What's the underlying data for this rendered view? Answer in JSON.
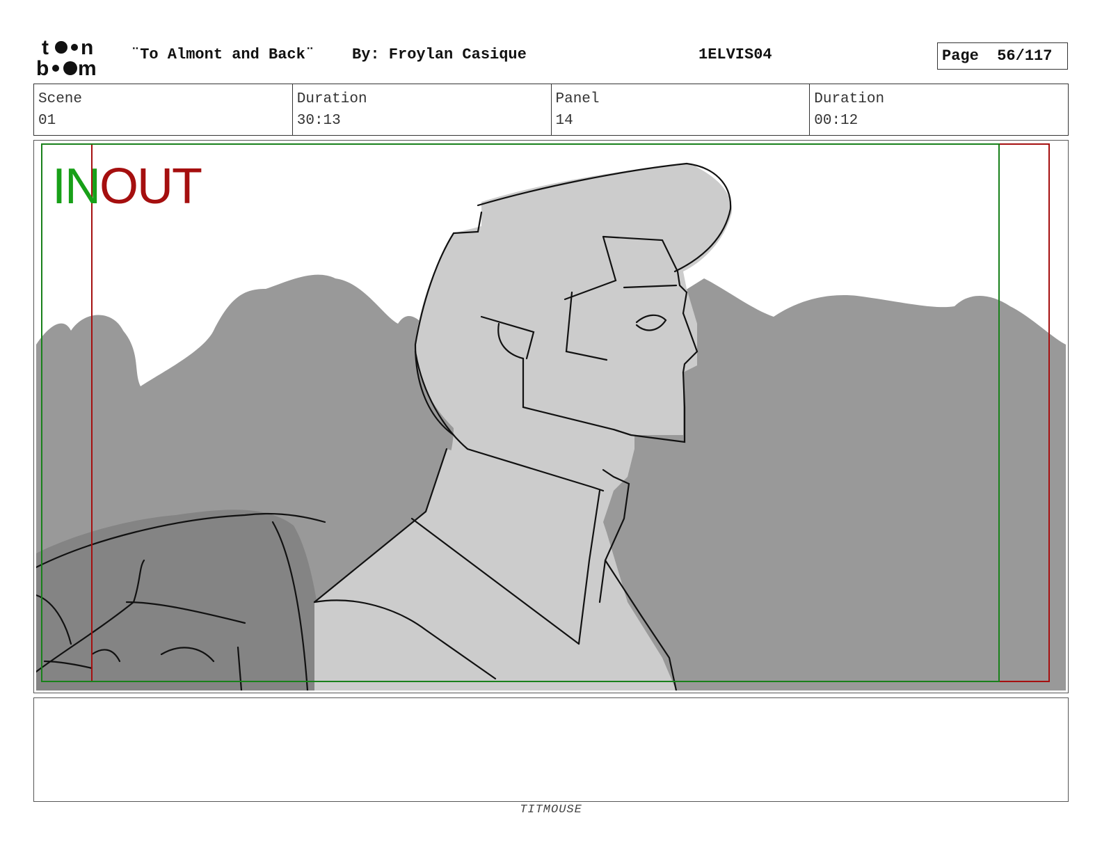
{
  "header": {
    "title": "¨To Almont and Back¨",
    "byline": "By: Froylan Casique",
    "code": "1ELVIS04",
    "page": "Page  56/117"
  },
  "info": [
    {
      "label": "Scene",
      "value": "01"
    },
    {
      "label": "Duration",
      "value": "30:13"
    },
    {
      "label": "Panel",
      "value": "14"
    },
    {
      "label": "Duration",
      "value": "00:12"
    }
  ],
  "panel": {
    "in_label": "IN",
    "out_label": "OUT",
    "in_color": "#18a018",
    "out_color": "#a50f0f"
  },
  "footer": "TITMOUSE"
}
